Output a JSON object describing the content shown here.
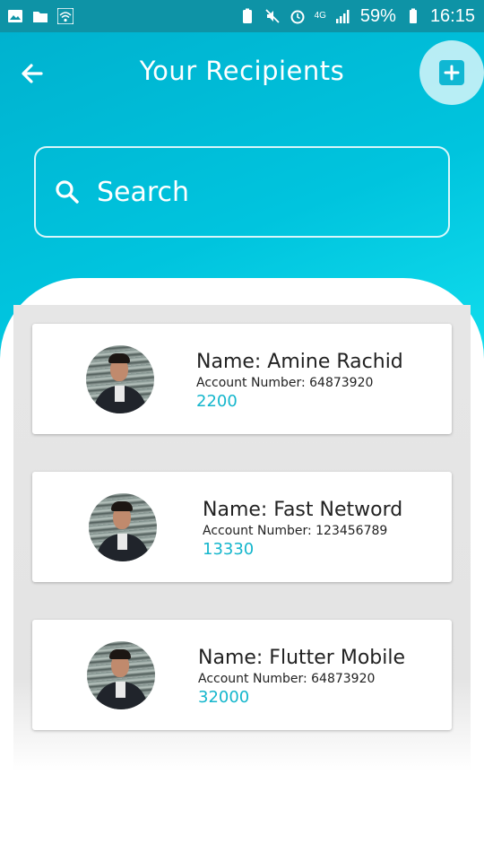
{
  "status_bar": {
    "battery": "59%",
    "time": "16:15",
    "network": "4G"
  },
  "header": {
    "title": "Your Recipients"
  },
  "search": {
    "placeholder": "Search"
  },
  "recipients": [
    {
      "name": "Name: Amine Rachid",
      "account": "Account Number: 64873920",
      "amount": "2200"
    },
    {
      "name": "Name: Fast Netword",
      "account": "Account Number: 123456789",
      "amount": "13330"
    },
    {
      "name": "Name: Flutter Mobile",
      "account": "Account Number: 64873920",
      "amount": "32000"
    }
  ],
  "colors": {
    "status_bar": "#0e93a6",
    "header_gradient_start": "#00b2cf",
    "header_gradient_end": "#12dfee",
    "accent": "#14b6cc"
  },
  "icons": {
    "back": "arrow-left-icon",
    "add": "add-square-icon",
    "search": "search-icon"
  }
}
